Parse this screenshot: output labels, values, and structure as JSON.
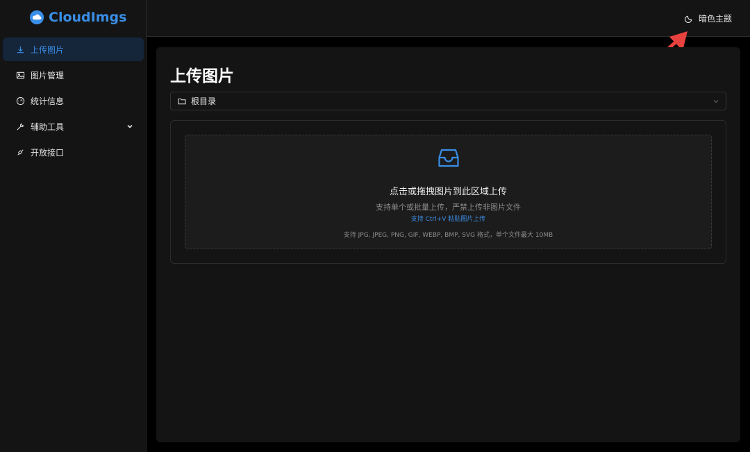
{
  "app": {
    "name": "CloudImgs",
    "brand_color": "#3a8ee6"
  },
  "sidebar": {
    "items": [
      {
        "label": "上传图片",
        "icon": "download-icon",
        "active": true
      },
      {
        "label": "图片管理",
        "icon": "image-icon",
        "active": false
      },
      {
        "label": "统计信息",
        "icon": "dashboard-icon",
        "active": false
      },
      {
        "label": "辅助工具",
        "icon": "tool-icon",
        "active": false,
        "has_submenu": true
      },
      {
        "label": "开放接口",
        "icon": "api-icon",
        "active": false
      }
    ]
  },
  "header": {
    "theme_label": "暗色主题",
    "theme_icon": "moon-icon"
  },
  "main": {
    "title": "上传图片",
    "directory": {
      "value": "根目录",
      "icon": "folder-icon"
    },
    "dropzone": {
      "title": "点击或拖拽图片到此区域上传",
      "subtitle": "支持单个或批量上传，严禁上传非图片文件",
      "paste_hint": "支持 Ctrl+V 粘贴图片上传",
      "formats": "支持 JPG, JPEG, PNG, GIF, WEBP, BMP, SVG 格式，单个文件最大 10MB",
      "icon": "inbox-icon"
    }
  },
  "colors": {
    "background": "#000000",
    "panel": "#141414",
    "active_item_bg": "#15253a",
    "accent": "#3a8ee6",
    "annotation": "#e8423f"
  }
}
